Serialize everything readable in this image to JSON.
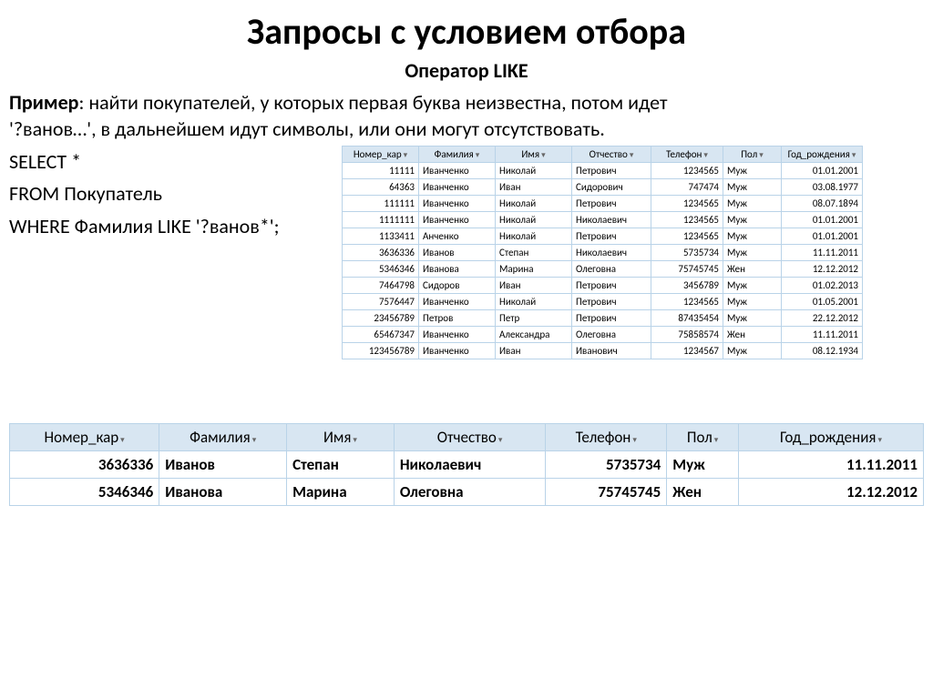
{
  "title": "Запросы с условием отбора",
  "subtitle": "Оператор LIKE",
  "example_label": "Пример",
  "example_text_1": ": найти покупателей, у которых первая буква неизвестна, потом идет",
  "example_text_2": "'?ванов…', в дальнейшем идут символы, или они могут отсутствовать.",
  "sql": {
    "l1": "SELECT *",
    "l2": "FROM Покупатель",
    "l3": "WHERE Фамилия LIKE '?ванов*';"
  },
  "table_source": {
    "headers": [
      "Номер_кар",
      "Фамилия",
      "Имя",
      "Отчество",
      "Телефон",
      "Пол",
      "Год_рождения"
    ],
    "rows": [
      [
        "11111",
        "Иванченко",
        "Николай",
        "Петрович",
        "1234565",
        "Муж",
        "01.01.2001"
      ],
      [
        "64363",
        "Иванченко",
        "Иван",
        "Сидорович",
        "747474",
        "Муж",
        "03.08.1977"
      ],
      [
        "111111",
        "Иванченко",
        "Николай",
        "Петрович",
        "1234565",
        "Муж",
        "08.07.1894"
      ],
      [
        "1111111",
        "Иванченко",
        "Николай",
        "Николаевич",
        "1234565",
        "Муж",
        "01.01.2001"
      ],
      [
        "1133411",
        "Анченко",
        "Николай",
        "Петрович",
        "1234565",
        "Муж",
        "01.01.2001"
      ],
      [
        "3636336",
        "Иванов",
        "Степан",
        "Николаевич",
        "5735734",
        "Муж",
        "11.11.2011"
      ],
      [
        "5346346",
        "Иванова",
        "Марина",
        "Олеговна",
        "75745745",
        "Жен",
        "12.12.2012"
      ],
      [
        "7464798",
        "Сидоров",
        "Иван",
        "Петрович",
        "3456789",
        "Муж",
        "01.02.2013"
      ],
      [
        "7576447",
        "Иванченко",
        "Николай",
        "Петрович",
        "1234565",
        "Муж",
        "01.05.2001"
      ],
      [
        "23456789",
        "Петров",
        "Петр",
        "Петрович",
        "87435454",
        "Муж",
        "22.12.2012"
      ],
      [
        "65467347",
        "Иванченко",
        "Александра",
        "Олеговна",
        "75858574",
        "Жен",
        "11.11.2011"
      ],
      [
        "123456789",
        "Иванченко",
        "Иван",
        "Иванович",
        "1234567",
        "Муж",
        "08.12.1934"
      ]
    ]
  },
  "table_result": {
    "headers": [
      "Номер_кар",
      "Фамилия",
      "Имя",
      "Отчество",
      "Телефон",
      "Пол",
      "Год_рождения"
    ],
    "rows": [
      [
        "3636336",
        "Иванов",
        "Степан",
        "Николаевич",
        "5735734",
        "Муж",
        "11.11.2011"
      ],
      [
        "5346346",
        "Иванова",
        "Марина",
        "Олеговна",
        "75745745",
        "Жен",
        "12.12.2012"
      ]
    ]
  }
}
